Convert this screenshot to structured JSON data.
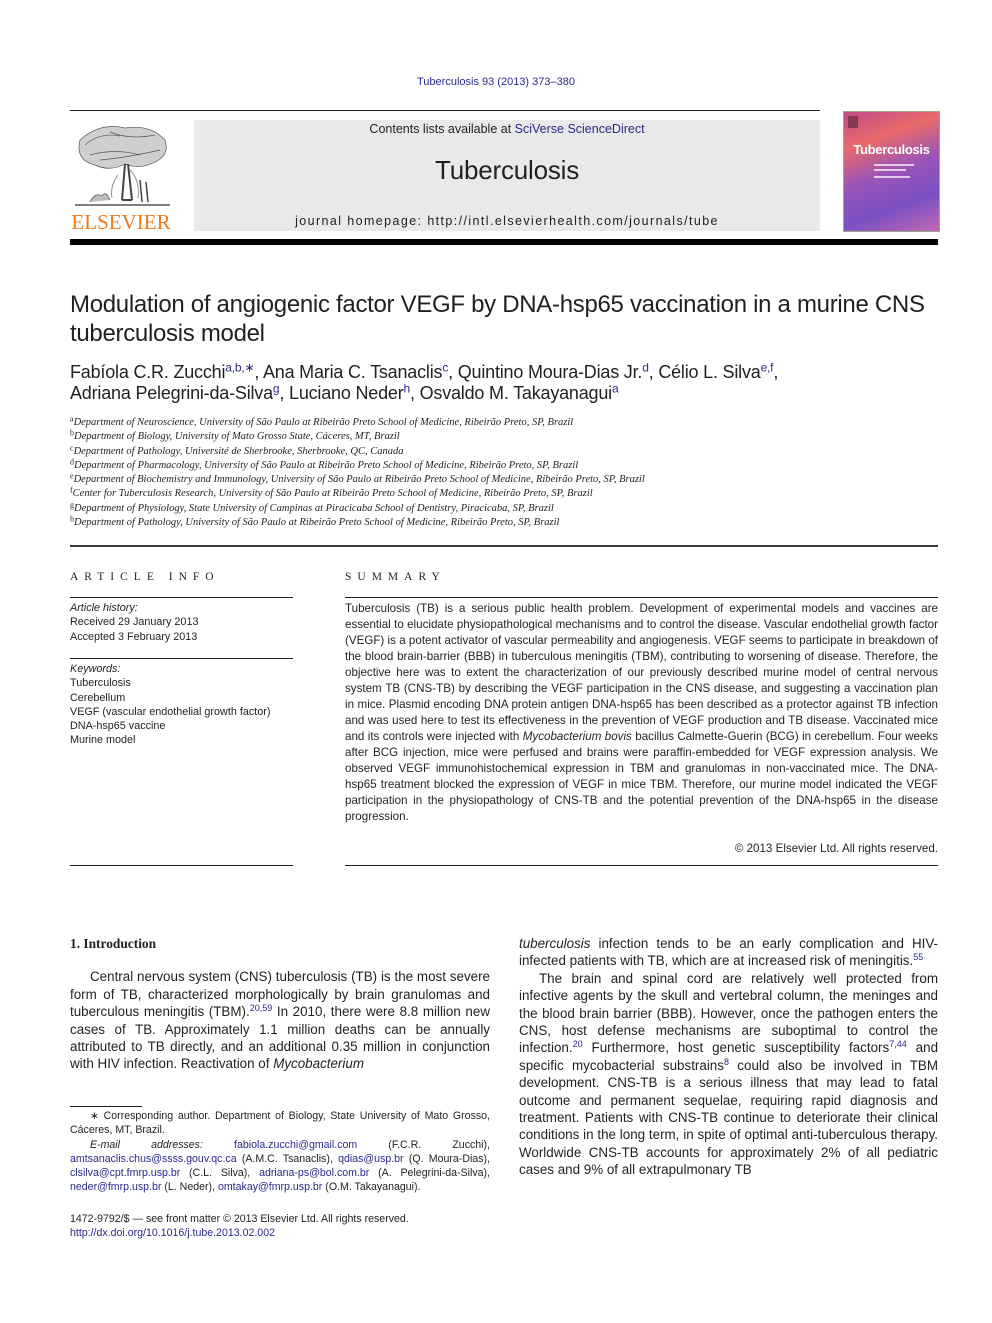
{
  "journal_ref": "Tuberculosis 93 (2013) 373–380",
  "header": {
    "contents_prefix": "Contents lists available at ",
    "contents_link": "SciVerse ScienceDirect",
    "journal_name": "Tuberculosis",
    "homepage_prefix": "journal homepage: ",
    "homepage_url": "http://intl.elsevierhealth.com/journals/tube",
    "publisher_logo_text": "ELSEVIER",
    "cover_title": "Tuberculosis",
    "colors": {
      "publisher_orange": "#f07a1a",
      "link_blue": "#2a2a8c",
      "header_gray": "#e9e9e9"
    }
  },
  "article": {
    "title": "Modulation of angiogenic factor VEGF by DNA-hsp65 vaccination in a murine CNS tuberculosis model",
    "authors": [
      {
        "name": "Fabíola C.R. Zucchi",
        "sup": "a,b,∗",
        "sep": ", "
      },
      {
        "name": "Ana Maria C. Tsanaclis",
        "sup": "c",
        "sep": ", "
      },
      {
        "name": "Quintino Moura-Dias Jr.",
        "sup": "d",
        "sep": ", "
      },
      {
        "name": "Célio L. Silva",
        "sup": "e,f",
        "sep": ","
      },
      {
        "name": "Adriana Pelegrini-da-Silva",
        "sup": "g",
        "sep": ", "
      },
      {
        "name": "Luciano Neder",
        "sup": "h",
        "sep": ", "
      },
      {
        "name": "Osvaldo M. Takayanagui",
        "sup": "a",
        "sep": ""
      }
    ],
    "affiliations": [
      {
        "key": "a",
        "text": "Department of Neuroscience, University of São Paulo at Ribeirão Preto School of Medicine, Ribeirão Preto, SP, Brazil"
      },
      {
        "key": "b",
        "text": "Department of Biology, University of Mato Grosso State, Cáceres, MT, Brazil"
      },
      {
        "key": "c",
        "text": "Department of Pathology, Université de Sherbrooke, Sherbrooke, QC, Canada"
      },
      {
        "key": "d",
        "text": "Department of Pharmacology, University of São Paulo at Ribeirão Preto School of Medicine, Ribeirão Preto, SP, Brazil"
      },
      {
        "key": "e",
        "text": "Department of Biochemistry and Immunology, University of São Paulo at Ribeirão Preto School of Medicine, Ribeirão Preto, SP, Brazil"
      },
      {
        "key": "f",
        "text": "Center for Tuberculosis Research, University of São Paulo at Ribeirão Preto School of Medicine, Ribeirão Preto, SP, Brazil"
      },
      {
        "key": "g",
        "text": "Department of Physiology, State University of Campinas at Piracicaba School of Dentistry, Piracicaba, SP, Brazil"
      },
      {
        "key": "h",
        "text": "Department of Pathology, University of São Paulo at Ribeirão Preto School of Medicine, Ribeirão Preto, SP, Brazil"
      }
    ]
  },
  "article_info": {
    "heading": "ARTICLE INFO",
    "history_label": "Article history:",
    "received": "Received 29 January 2013",
    "accepted": "Accepted 3 February 2013",
    "keywords_label": "Keywords:",
    "keywords": [
      "Tuberculosis",
      "Cerebellum",
      "VEGF (vascular endothelial growth factor)",
      "DNA-hsp65 vaccine",
      "Murine model"
    ]
  },
  "summary": {
    "heading": "SUMMARY",
    "text_1": "Tuberculosis (TB) is a serious public health problem. Development of experimental models and vaccines are essential to elucidate physiopathological mechanisms and to control the disease. Vascular endothelial growth factor (VEGF) is a potent activator of vascular permeability and angiogenesis. VEGF seems to participate in breakdown of the blood brain-barrier (BBB) in tuberculous meningitis (TBM), contributing to worsening of disease. Therefore, the objective here was to extent the characterization of our previously described murine model of central nervous system TB (CNS-TB) by describing the VEGF participation in the CNS disease, and suggesting a vaccination plan in mice. Plasmid encoding DNA protein antigen DNA-hsp65 has been described as a protector against TB infection and was used here to test its effectiveness in the prevention of VEGF production and TB disease. Vaccinated mice and its controls were injected with ",
    "text_italic": "Mycobacterium bovis",
    "text_2": " bacillus Calmette-Guerin (BCG) in cerebellum. Four weeks after BCG injection, mice were perfused and brains were paraffin-embedded for VEGF expression analysis. We observed VEGF immunohistochemical expression in TBM and granulomas in non-vaccinated mice. The DNA-hsp65 treatment blocked the expression of VEGF in mice TBM. Therefore, our murine model indicated the VEGF participation in the physiopathology of CNS-TB and the potential prevention of the DNA-hsp65 in the disease progression.",
    "copyright": "© 2013 Elsevier Ltd. All rights reserved."
  },
  "introduction": {
    "heading": "1.  Introduction",
    "p1_a": "Central nervous system (CNS) tuberculosis (TB) is the most se­vere form of TB, characterized morphologically by brain granu­lomas and tuberculous meningitis (TBM).",
    "p1_ref1": "20,59",
    "p1_b": " In 2010, there were 8.8 million new cases of TB. Approximately 1.1 million deaths can be annually attributed to TB directly, and an additional 0.35 million in conjunction with HIV infection. Reactivation of ",
    "p1_italic": "Mycobacterium",
    "p1_italic2": "tuberculosis",
    "p1_c": " infection tends to be an early complication and HIV-infected patients with TB, which are at increased risk of meningitis.",
    "p1_ref2": "55",
    "p2_a": "The brain and spinal cord are relatively well protected from infective agents by the skull and vertebral column, the meninges and the blood brain barrier (BBB). However, once the pathogen enters the CNS, host defense mechanisms are suboptimal to control the infection.",
    "p2_ref1": "20",
    "p2_b": " Furthermore, host genetic susceptibility factors",
    "p2_ref2": "7,44",
    "p2_c": " and specific mycobacterial substrains",
    "p2_ref3": "8",
    "p2_d": " could also be involved in TBM development. CNS-TB is a serious illness that may lead to fatal outcome and permanent sequelae, requiring rapid diagnosis and treatment. Patients with CNS-TB continue to deteriorate their clinical conditions in the long term, in spite of optimal anti-tuberculous therapy. Worldwide CNS-TB accounts for approxi­mately 2% of all pediatric cases and 9% of all extrapulmonary TB"
  },
  "footnote": {
    "star": "∗",
    "corresponding": " Corresponding author. Department of Biology, State University of Mato Grosso, Cáceres, MT, Brazil.",
    "email_label": "E-mail addresses:",
    "emails": [
      {
        "email": "fabiola.zucchi@gmail.com",
        "who": " (F.C.R. Zucchi), "
      },
      {
        "email": "amtsanaclis.chus@ssss.gouv.qc.ca",
        "who": " (A.M.C. Tsanaclis), "
      },
      {
        "email": "qdias@usp.br",
        "who": " (Q. Moura-Dias), "
      },
      {
        "email": "clsilva@cpt.fmrp.usp.br",
        "who": " (C.L. Silva), "
      },
      {
        "email": "adriana-ps@bol.com.br",
        "who": " (A. Pelegrini-da-Silva), "
      },
      {
        "email": "neder@fmrp.usp.br",
        "who": " (L. Neder), "
      },
      {
        "email": "omtakay@fmrp.usp.br",
        "who": " (O.M. Takayanagui)."
      }
    ]
  },
  "front_matter": {
    "line": "1472-9792/$ — see front matter © 2013 Elsevier Ltd. All rights reserved.",
    "doi": "http://dx.doi.org/10.1016/j.tube.2013.02.002"
  }
}
